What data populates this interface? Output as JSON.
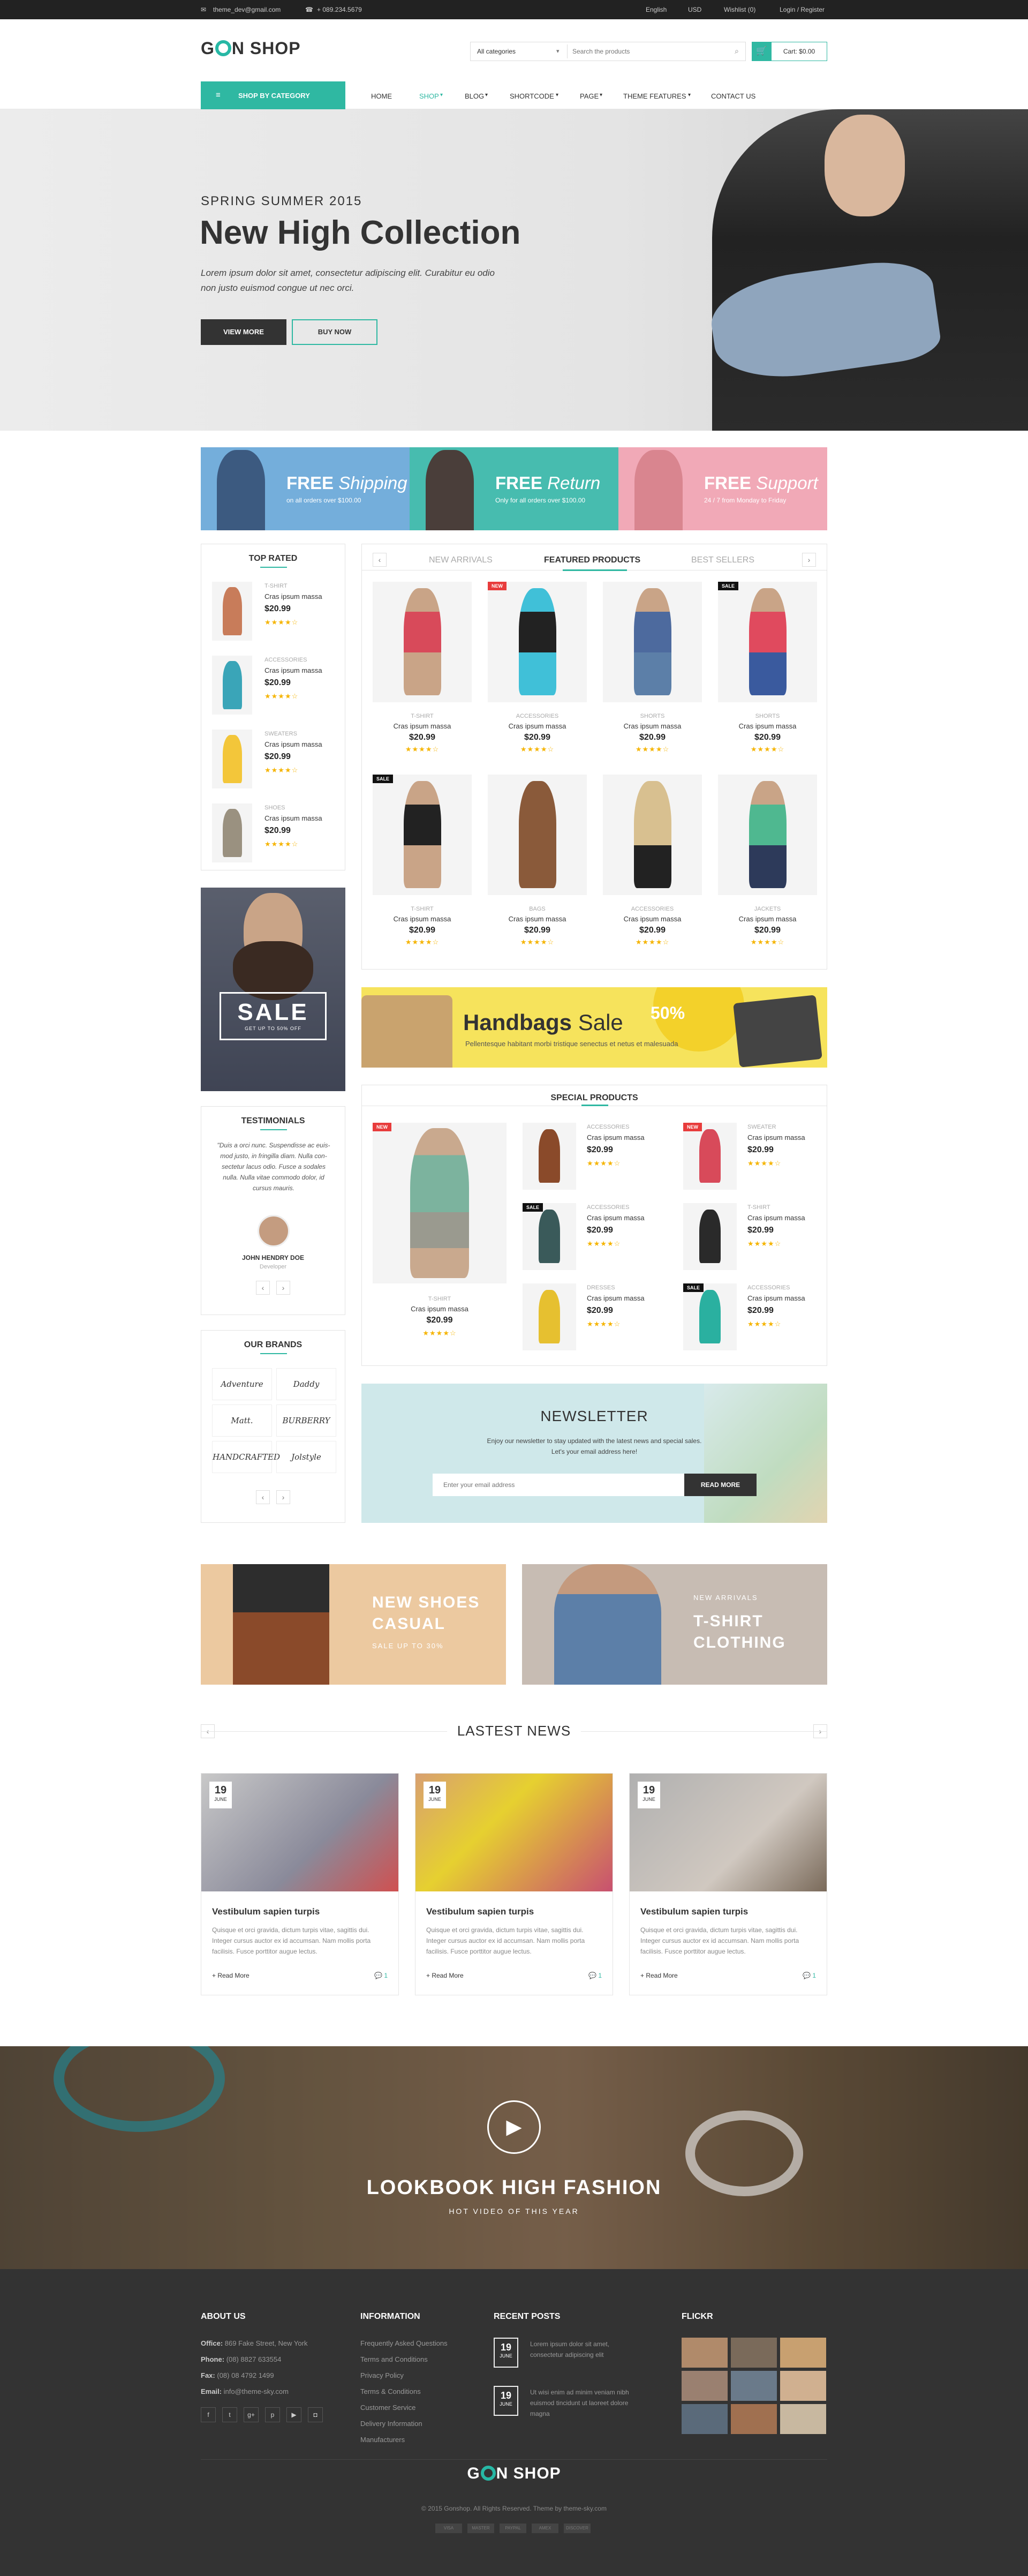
{
  "topbar": {
    "email": "theme_dev@gmail.com",
    "phone": "+ 089.234.5679",
    "language": "English",
    "currency": "USD",
    "wishlist": "Wishlist (0)",
    "login": "Login / Register"
  },
  "header": {
    "logo_left": "G",
    "logo_right": "N SHOP",
    "category_select": "All categories",
    "search_placeholder": "Search the products",
    "cart": "Cart: $0.00"
  },
  "nav": {
    "shop_by_category": "SHOP BY CATEGORY",
    "items": [
      "HOME",
      "SHOP",
      "BLOG",
      "SHORTCODE",
      "PAGE",
      "THEME FEATURES",
      "CONTACT US"
    ]
  },
  "hero": {
    "kicker": "SPRING SUMMER 2015",
    "title": "New High Collection",
    "text": "Lorem ipsum dolor sit amet, consectetur adipiscing elit. Curabitur eu odio non justo euismod congue ut nec orci.",
    "btn_primary": "VIEW MORE",
    "btn_secondary": "BUY NOW"
  },
  "promos": [
    {
      "title_bold": "FREE",
      "title_italic": "Shipping",
      "sub": "on all orders over $100.00",
      "color": "#74aedb"
    },
    {
      "title_bold": "FREE",
      "title_italic": "Return",
      "sub": "Only for all orders over $100.00",
      "color": "#47bcaf"
    },
    {
      "title_bold": "FREE",
      "title_italic": "Support",
      "sub": "24 / 7 from Monday to Friday",
      "color": "#f1a9b7"
    }
  ],
  "top_rated": {
    "title": "TOP RATED",
    "items": [
      {
        "cat": "T-SHIRT",
        "name": "Cras ipsum massa",
        "price": "$20.99"
      },
      {
        "cat": "ACCESSORIES",
        "name": "Cras ipsum massa",
        "price": "$20.99"
      },
      {
        "cat": "SWEATERS",
        "name": "Cras ipsum massa",
        "price": "$20.99"
      },
      {
        "cat": "SHOES",
        "name": "Cras ipsum massa",
        "price": "$20.99"
      }
    ]
  },
  "sale_banner": {
    "text": "SALE",
    "sub": "GET UP TO 50% OFF"
  },
  "testimonials": {
    "title": "TESTIMONIALS",
    "quote": "\"Duis a orci nunc. Suspendisse ac euis- mod justo, in fringilla diam. Nulla con- sectetur lacus odio. Fusce a sodales nulla. Nulla vitae commodo dolor, id cursus mauris.",
    "name": "JOHN HENDRY DOE",
    "role": "Developer"
  },
  "brands": {
    "title": "OUR BRANDS",
    "items": [
      "Adventure",
      "Daddy",
      "Matt.",
      "BURBERRY",
      "HANDCRAFTED",
      "Jolstyle"
    ]
  },
  "tabs": [
    "NEW ARRIVALS",
    "FEATURED PRODUCTS",
    "BEST SELLERS"
  ],
  "products": [
    {
      "cat": "T-SHIRT",
      "name": "Cras ipsum massa",
      "price": "$20.99",
      "badge": ""
    },
    {
      "cat": "ACCESSORIES",
      "name": "Cras ipsum massa",
      "price": "$20.99",
      "badge": "NEW"
    },
    {
      "cat": "SHORTS",
      "name": "Cras ipsum massa",
      "price": "$20.99",
      "badge": ""
    },
    {
      "cat": "SHORTS",
      "name": "Cras ipsum massa",
      "price": "$20.99",
      "badge": "SALE"
    },
    {
      "cat": "T-SHIRT",
      "name": "Cras ipsum massa",
      "price": "$20.99",
      "badge": "SALE"
    },
    {
      "cat": "BAGS",
      "name": "Cras ipsum massa",
      "price": "$20.99",
      "badge": ""
    },
    {
      "cat": "ACCESSORIES",
      "name": "Cras ipsum massa",
      "price": "$20.99",
      "badge": ""
    },
    {
      "cat": "JACKETS",
      "name": "Cras ipsum massa",
      "price": "$20.99",
      "badge": ""
    }
  ],
  "handbags": {
    "title_bold": "Handbags",
    "title_light": "Sale",
    "text": "Pellentesque habitant morbi tristique senectus et netus et malesuada",
    "percent": "50%"
  },
  "special": {
    "title": "SPECIAL PRODUCTS",
    "big": {
      "cat": "T-SHIRT",
      "name": "Cras ipsum massa",
      "price": "$20.99",
      "badge": "NEW"
    },
    "items": [
      {
        "cat": "ACCESSORIES",
        "name": "Cras ipsum massa",
        "price": "$20.99",
        "badge": ""
      },
      {
        "cat": "SWEATER",
        "name": "Cras ipsum massa",
        "price": "$20.99",
        "badge": "NEW"
      },
      {
        "cat": "ACCESSORIES",
        "name": "Cras ipsum massa",
        "price": "$20.99",
        "badge": "SALE"
      },
      {
        "cat": "T-SHIRT",
        "name": "Cras ipsum massa",
        "price": "$20.99",
        "badge": ""
      },
      {
        "cat": "DRESSES",
        "name": "Cras ipsum massa",
        "price": "$20.99",
        "badge": ""
      },
      {
        "cat": "ACCESSORIES",
        "name": "Cras ipsum massa",
        "price": "$20.99",
        "badge": "SALE"
      }
    ]
  },
  "newsletter": {
    "title": "NEWSLETTER",
    "text1": "Enjoy our newsletter to stay updated with the latest news and special sales.",
    "text2": "Let's your email address here!",
    "placeholder": "Enter your email address",
    "button": "READ MORE"
  },
  "banners": [
    {
      "line1": "NEW SHOES",
      "line2": "CASUAL",
      "sub": "SALE UP TO 30%"
    },
    {
      "kicker": "NEW ARRIVALS",
      "line1": "T-SHIRT",
      "line2": "CLOTHING"
    }
  ],
  "news": {
    "title": "LASTEST NEWS",
    "posts": [
      {
        "day": "19",
        "month": "JUNE",
        "title": "Vestibulum sapien turpis",
        "text": "Quisque et orci gravida, dictum turpis vitae, sagittis dui. Integer cursus auctor ex id accumsan. Nam mollis porta facilisis. Fusce porttitor augue lectus.",
        "more": "+ Read More",
        "comments": "1"
      },
      {
        "day": "19",
        "month": "JUNE",
        "title": "Vestibulum sapien turpis",
        "text": "Quisque et orci gravida, dictum turpis vitae, sagittis dui. Integer cursus auctor ex id accumsan. Nam mollis porta facilisis. Fusce porttitor augue lectus.",
        "more": "+ Read More",
        "comments": "1"
      },
      {
        "day": "19",
        "month": "JUNE",
        "title": "Vestibulum sapien turpis",
        "text": "Quisque et orci gravida, dictum turpis vitae, sagittis dui. Integer cursus auctor ex id accumsan. Nam mollis porta facilisis. Fusce porttitor augue lectus.",
        "more": "+ Read More",
        "comments": "1"
      }
    ]
  },
  "lookbook": {
    "title": "LOOKBOOK HIGH FASHION",
    "sub": "HOT VIDEO OF THIS YEAR"
  },
  "footer": {
    "about": {
      "title": "ABOUT US",
      "office_label": "Office:",
      "office": "869 Fake Street, New York",
      "phone_label": "Phone:",
      "phone": "(08) 8827 633554",
      "fax_label": "Fax:",
      "fax": "(08) 08 4792 1499",
      "email_label": "Email:",
      "email": "info@theme-sky.com"
    },
    "info": {
      "title": "INFORMATION",
      "links": [
        "Frequently Asked Questions",
        "Terms and Conditions",
        "Privacy Policy",
        "Terms & Conditions",
        "Customer Service",
        "Delivery Information",
        "Manufacturers"
      ]
    },
    "recent": {
      "title": "RECENT POSTS",
      "posts": [
        {
          "day": "19",
          "month": "JUNE",
          "text": "Lorem ipsum dolor sit amet, consectetur adipiscing elit"
        },
        {
          "day": "19",
          "month": "JUNE",
          "text": "Ut wisi enim ad minim veniam nibh euismod tincidunt ut laoreet dolore magna"
        }
      ]
    },
    "flickr": {
      "title": "FLICKR"
    },
    "logo_left": "G",
    "logo_right": "N SHOP",
    "copyright": "© 2015 Gonshop. All Rights Reserved. Theme by theme-sky.com",
    "payments": [
      "VISA",
      "MASTER",
      "PAYPAL",
      "AMEX",
      "DISCOVER"
    ]
  }
}
